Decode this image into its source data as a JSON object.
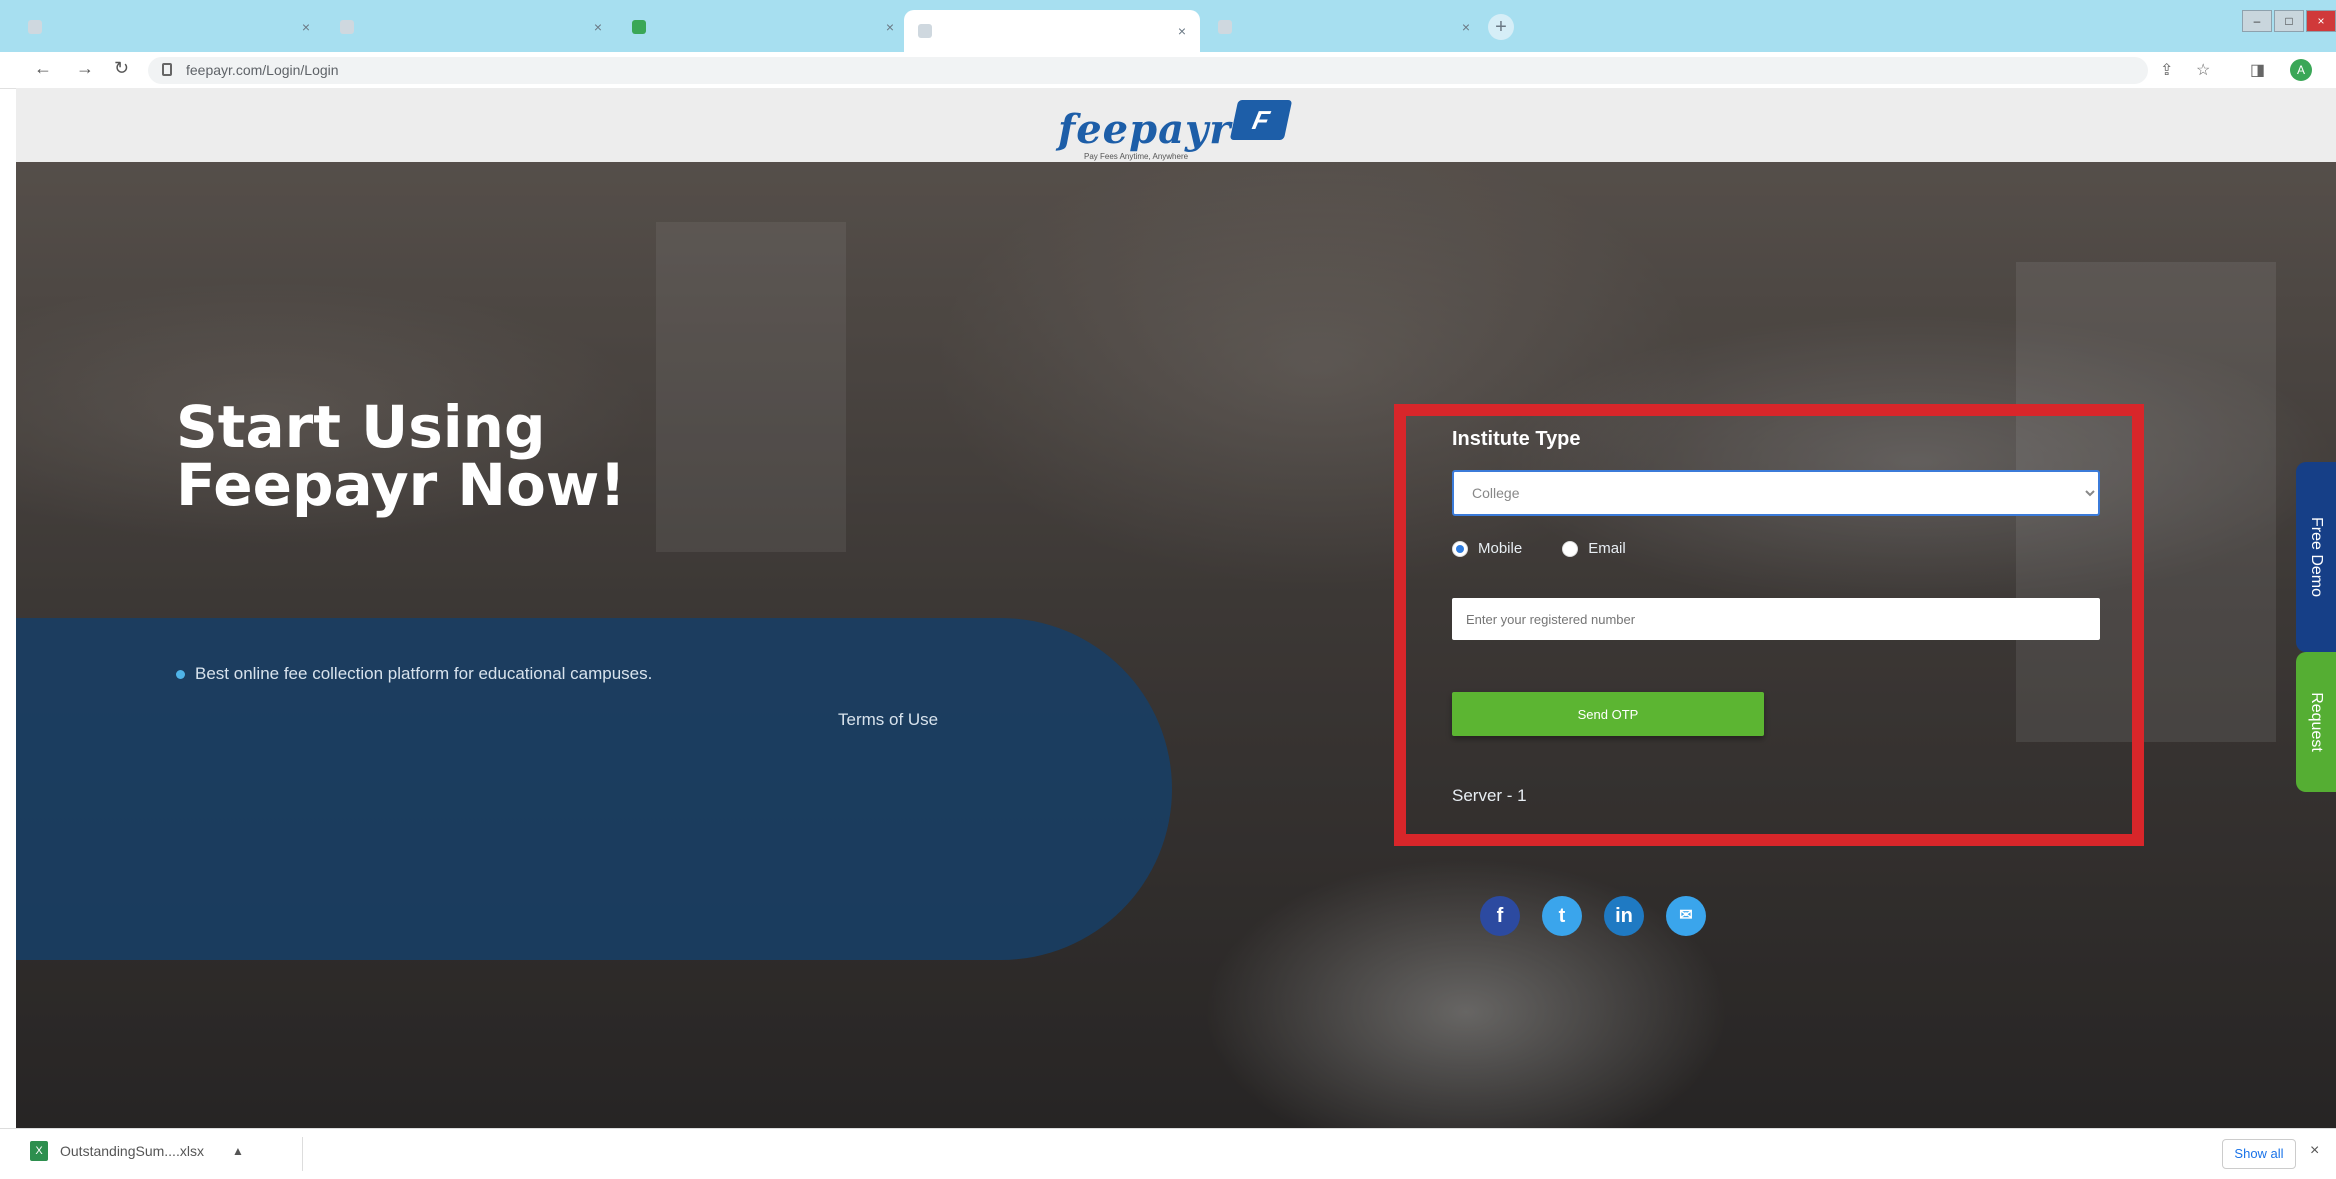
{
  "browser": {
    "tabs": [
      {
        "title": "",
        "active": false
      },
      {
        "title": "",
        "active": false
      },
      {
        "title": "",
        "active": false
      },
      {
        "title": "",
        "active": true
      },
      {
        "title": "",
        "active": false
      }
    ],
    "url": "feepayr.com/Login/Login"
  },
  "header": {
    "logo_text": "feepayr",
    "logo_mark": "F",
    "tagline": "Pay Fees Anytime, Anywhere"
  },
  "hero": {
    "headline": "Start Using Feepayr Now!",
    "bullet": "Best online fee collection platform for educational campuses.",
    "terms_link": "Terms of Use"
  },
  "login": {
    "institute_label": "Institute Type",
    "institute_selected": "College",
    "radio_mobile": "Mobile",
    "radio_email": "Email",
    "selected_contact": "Mobile",
    "number_placeholder": "Enter your registered number",
    "send_otp": "Send OTP",
    "server": "Server - 1"
  },
  "socials": {
    "facebook": "f",
    "twitter": "t",
    "linkedin": "in",
    "email": "✉"
  },
  "side_tabs": {
    "demo": "Free Demo",
    "request": "Request"
  },
  "downloads": {
    "file": "OutstandingSum....xlsx",
    "show_all": "Show all"
  },
  "colors": {
    "highlight_border": "#d8262a",
    "send_otp_green": "#5cb532",
    "brand_blue": "#1d5ea8",
    "panel_blue": "#183f65"
  },
  "icons": [
    "back-arrow-icon",
    "forward-arrow-icon",
    "reload-icon",
    "lock-icon",
    "share-icon",
    "star-icon",
    "sidebar-icon",
    "profile-icon",
    "facebook-icon",
    "twitter-icon",
    "linkedin-icon",
    "email-icon",
    "excel-file-icon",
    "chevron-up-icon",
    "close-icon"
  ]
}
